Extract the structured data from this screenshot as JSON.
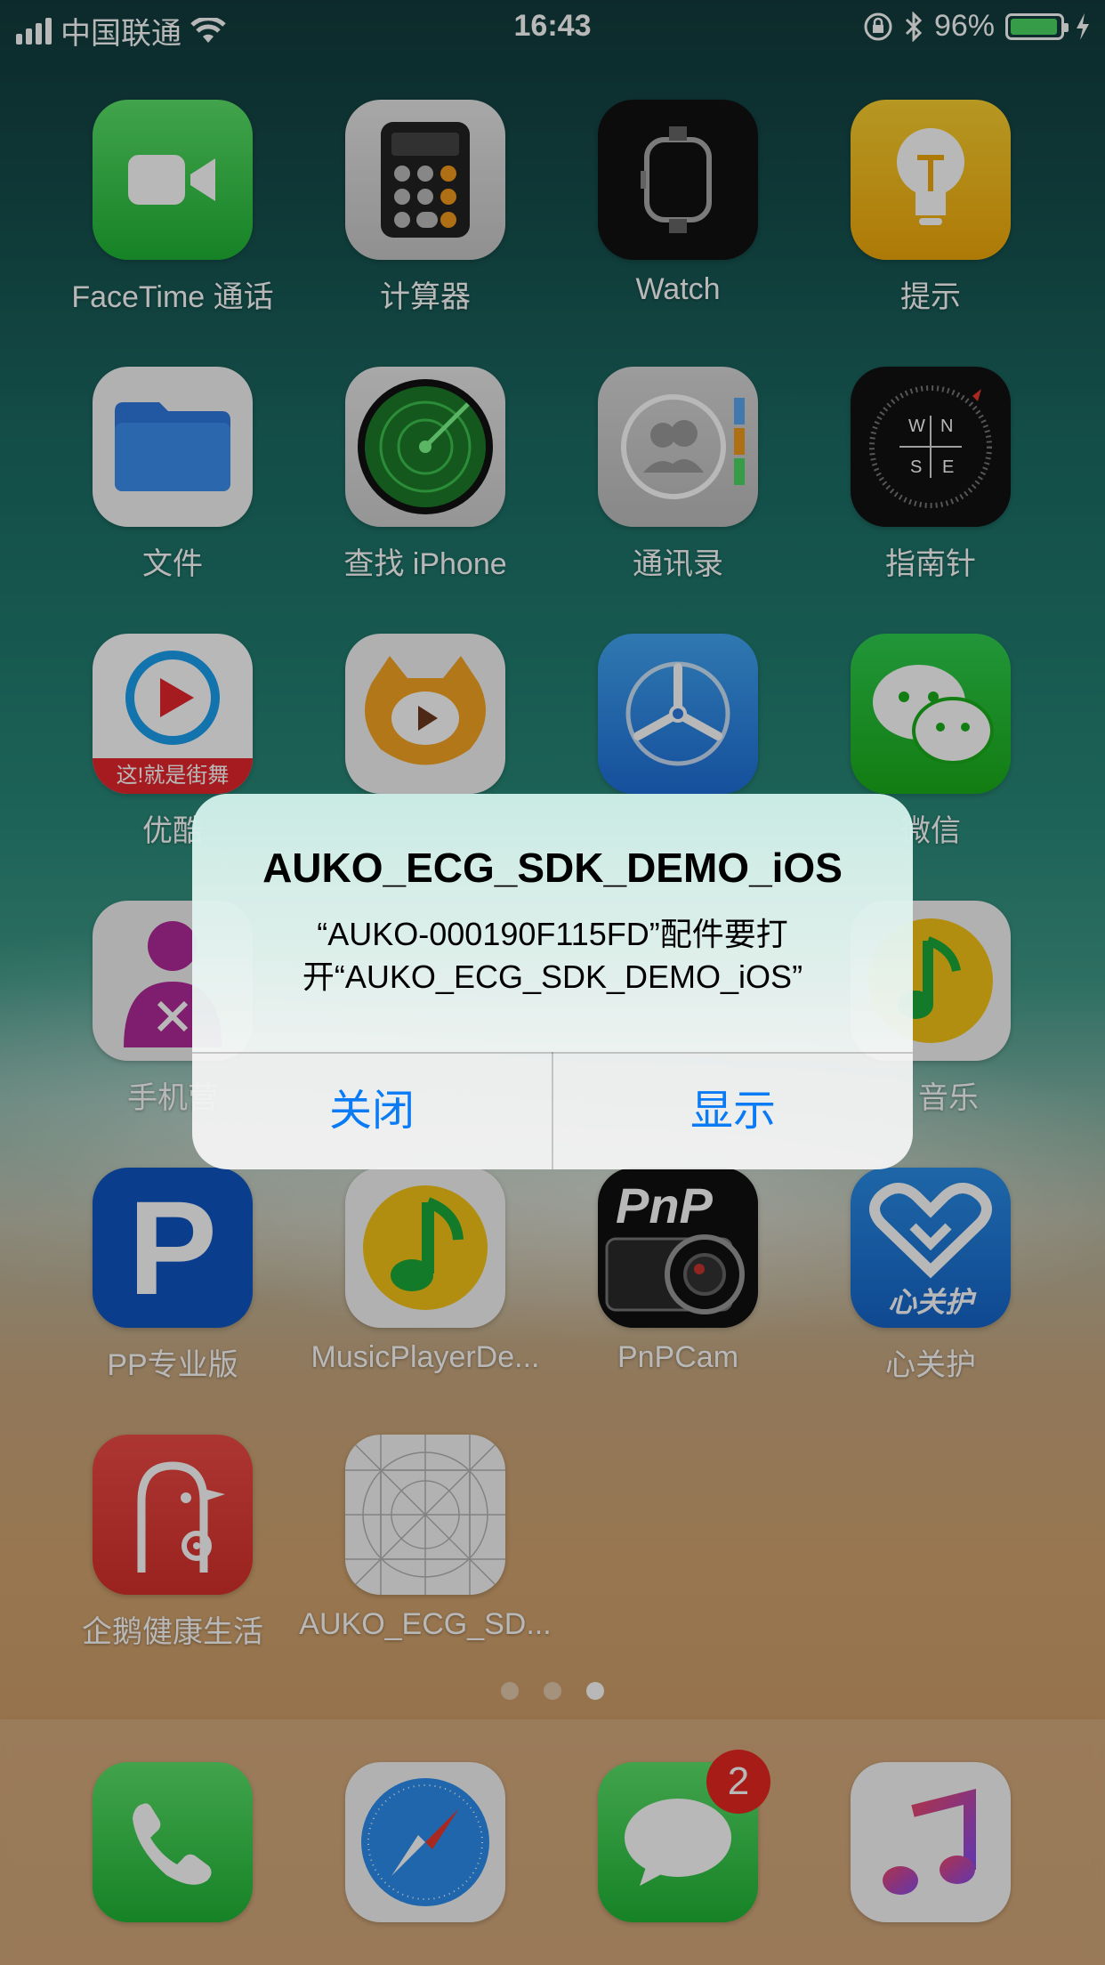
{
  "status_bar": {
    "carrier": "中国联通",
    "time": "16:43",
    "battery": "96%",
    "battery_level": 0.96
  },
  "apps": [
    {
      "label": "FaceTime 通话",
      "icon": "facetime-icon"
    },
    {
      "label": "计算器",
      "icon": "calculator-icon"
    },
    {
      "label": "Watch",
      "icon": "watch-icon"
    },
    {
      "label": "提示",
      "icon": "tips-icon"
    },
    {
      "label": "文件",
      "icon": "files-icon"
    },
    {
      "label": "查找 iPhone",
      "icon": "find-iphone-icon"
    },
    {
      "label": "通讯录",
      "icon": "contacts-icon"
    },
    {
      "label": "指南针",
      "icon": "compass-icon"
    },
    {
      "label": "优酷",
      "icon": "youku-icon",
      "icon_text": "这!就是街舞"
    },
    {
      "label": "",
      "icon": "huya-icon"
    },
    {
      "label": "",
      "icon": "testflight-icon"
    },
    {
      "label": "微信",
      "icon": "wechat-icon"
    },
    {
      "label": "手机营",
      "icon": "unicom-icon"
    },
    {
      "label": "",
      "icon": "blank-icon"
    },
    {
      "label": "",
      "icon": "blank-icon"
    },
    {
      "label": "音乐",
      "icon": "qqmusic-icon"
    },
    {
      "label": "PP专业版",
      "icon": "pp-icon",
      "icon_text": "P"
    },
    {
      "label": "MusicPlayerDe...",
      "icon": "musicplayer-icon"
    },
    {
      "label": "PnPCam",
      "icon": "pnpcam-icon",
      "icon_text": "PnP"
    },
    {
      "label": "心关护",
      "icon": "xinguanhu-icon",
      "icon_text": "心关护"
    },
    {
      "label": "企鹅健康生活",
      "icon": "penguin-health-icon"
    },
    {
      "label": "AUKO_ECG_SD...",
      "icon": "placeholder-app-icon"
    }
  ],
  "page_dots": {
    "count": 3,
    "active": 2
  },
  "dock": [
    {
      "label": "",
      "icon": "phone-icon"
    },
    {
      "label": "",
      "icon": "safari-icon"
    },
    {
      "label": "",
      "icon": "messages-icon",
      "badge": "2"
    },
    {
      "label": "",
      "icon": "music-icon"
    }
  ],
  "alert": {
    "title": "AUKO_ECG_SDK_DEMO_iOS",
    "message_line1": "“AUKO-000190F115FD”配件要打",
    "message_line2": "开“AUKO_ECG_SDK_DEMO_iOS”",
    "close_label": "关闭",
    "show_label": "显示"
  }
}
